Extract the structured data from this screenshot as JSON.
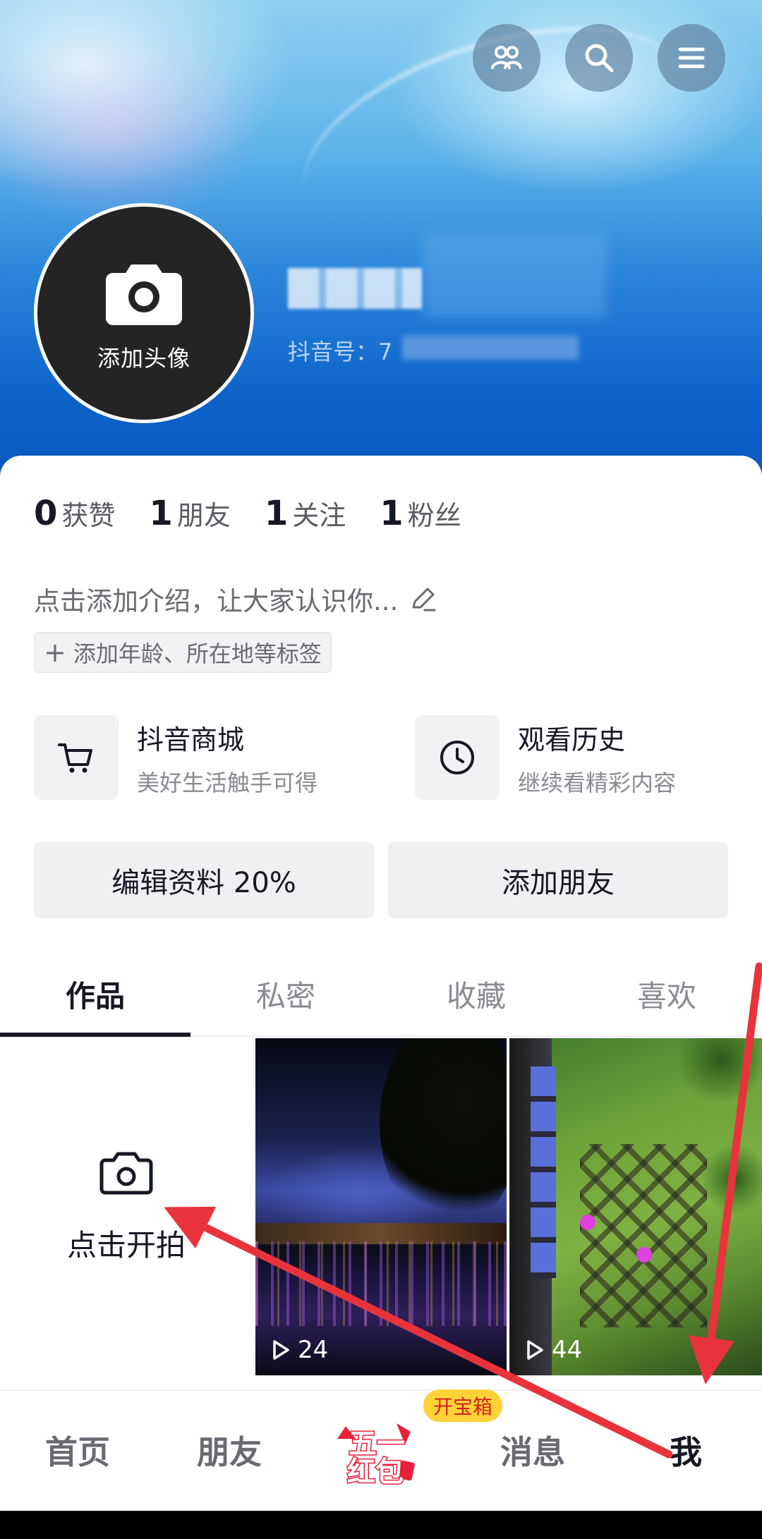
{
  "header": {
    "top_icons": [
      "friends-icon",
      "search-icon",
      "menu-icon"
    ],
    "avatar_label": "添加头像",
    "douyin_id_prefix": "抖音号：7"
  },
  "stats": [
    {
      "num": "0",
      "label": "获赞"
    },
    {
      "num": "1",
      "label": "朋友"
    },
    {
      "num": "1",
      "label": "关注"
    },
    {
      "num": "1",
      "label": "粉丝"
    }
  ],
  "bio": {
    "placeholder": "点击添加介绍，让大家认识你...",
    "tag_chip": "添加年龄、所在地等标签"
  },
  "features": [
    {
      "title": "抖音商城",
      "sub": "美好生活触手可得",
      "icon": "cart-icon"
    },
    {
      "title": "观看历史",
      "sub": "继续看精彩内容",
      "icon": "clock-icon"
    }
  ],
  "buttons": {
    "edit_profile": "编辑资料 20%",
    "add_friends": "添加朋友"
  },
  "tabs": [
    "作品",
    "私密",
    "收藏",
    "喜欢"
  ],
  "grid": {
    "shoot_label": "点击开拍",
    "videos": [
      {
        "plays": "24"
      },
      {
        "plays": "44"
      }
    ]
  },
  "bottom_nav": {
    "items": [
      "首页",
      "朋友",
      "消息",
      "我"
    ],
    "promo_badge": "开宝箱",
    "promo_text_top": "五一",
    "promo_text_bottom": "红包"
  },
  "colors": {
    "accent_text": "#161823",
    "promo_red": "#e8203a",
    "promo_badge_bg": "#ffd338",
    "annotation_arrow": "#e8333c"
  }
}
